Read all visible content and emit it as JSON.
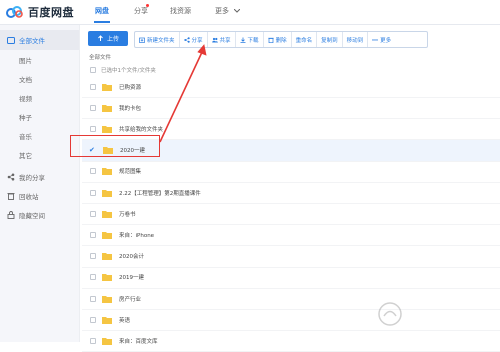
{
  "app": {
    "name": "百度网盘"
  },
  "nav": [
    {
      "label": "网盘"
    },
    {
      "label": "分享"
    },
    {
      "label": "找资源"
    },
    {
      "label": "更多"
    }
  ],
  "sidebar": {
    "items": [
      {
        "label": "全部文件",
        "icon": "folder-icon"
      },
      {
        "label": "图片"
      },
      {
        "label": "文档"
      },
      {
        "label": "视频"
      },
      {
        "label": "种子"
      },
      {
        "label": "音乐"
      },
      {
        "label": "其它"
      },
      {
        "label": "我的分享",
        "icon": "share-icon"
      },
      {
        "label": "回收站",
        "icon": "trash-icon"
      },
      {
        "label": "隐藏空间",
        "icon": "lock-icon"
      }
    ]
  },
  "toolbar": {
    "upload_label": "上传",
    "buttons": [
      {
        "label": "新建文件夹",
        "icon": "new-folder-icon"
      },
      {
        "label": "分享",
        "icon": "share-icon"
      },
      {
        "label": "共享",
        "icon": "users-icon"
      },
      {
        "label": "下载",
        "icon": "download-icon"
      },
      {
        "label": "删除",
        "icon": "delete-icon"
      },
      {
        "label": "重命名"
      },
      {
        "label": "复制到"
      },
      {
        "label": "移动到"
      },
      {
        "label": "更多",
        "icon": "more-icon"
      }
    ]
  },
  "breadcrumb": {
    "label": "全部文件"
  },
  "list": {
    "header": "已选中1个文件/文件夹",
    "rows": [
      {
        "name": "已购资源"
      },
      {
        "name": "我的卡包"
      },
      {
        "name": "共享给我的文件夹"
      },
      {
        "name": "2020一建",
        "selected": true
      },
      {
        "name": "规范图集"
      },
      {
        "name": "2.22【工程管理】第2期直播课件"
      },
      {
        "name": "万卷书"
      },
      {
        "name": "来自：iPhone"
      },
      {
        "name": "2020会计"
      },
      {
        "name": "2019一建"
      },
      {
        "name": "房产行业"
      },
      {
        "name": "英语"
      },
      {
        "name": "来自：百度文库"
      }
    ]
  },
  "colors": {
    "accent": "#2a7de1",
    "annotation": "#e53935",
    "folder": "#f5c542"
  }
}
